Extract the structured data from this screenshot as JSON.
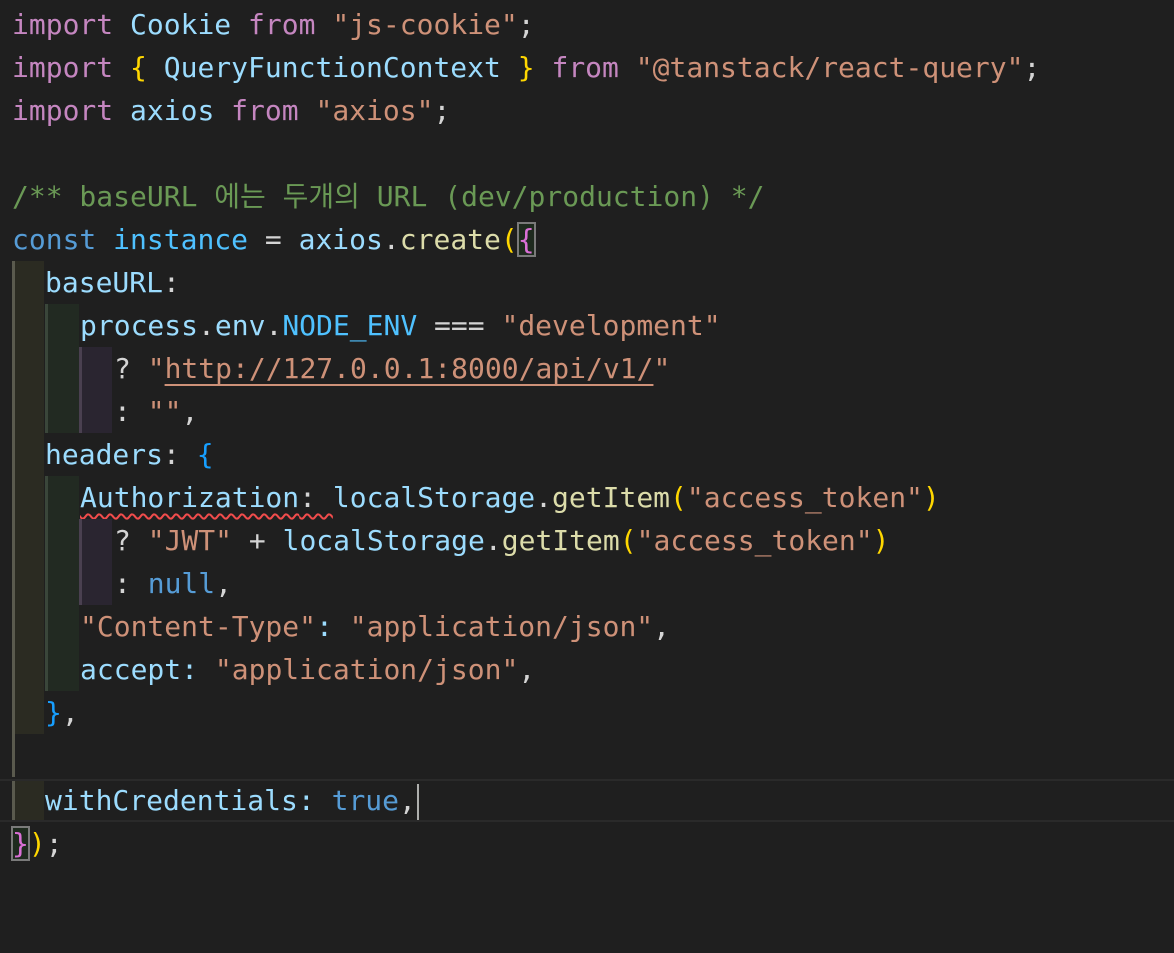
{
  "editor": {
    "theme_colors": {
      "background": "#1f1f1f",
      "keyword": "#c586c0",
      "storage": "#569cd6",
      "variable": "#9cdcfe",
      "constant": "#4fc1ff",
      "function": "#dcdcaa",
      "string": "#ce9178",
      "comment": "#6a9955",
      "error_squiggle": "#f14c4c"
    },
    "lines": {
      "l1": {
        "kw": "import",
        "name": "Cookie",
        "from": "from",
        "source": "\"js-cookie\"",
        "semi": ";"
      },
      "l2": {
        "kw": "import",
        "open": "{",
        "name": "QueryFunctionContext",
        "close": "}",
        "from": "from",
        "source": "\"@tanstack/react-query\"",
        "semi": ";"
      },
      "l3": {
        "kw": "import",
        "name": "axios",
        "from": "from",
        "source": "\"axios\"",
        "semi": ";"
      },
      "l5": {
        "comment": "/** baseURL 에는 두개의 URL (dev/production) */"
      },
      "l6": {
        "kw": "const",
        "name": "instance",
        "eq": " = ",
        "obj": "axios",
        "dot": ".",
        "fn": "create",
        "paren": "(",
        "brace": "{"
      },
      "l7": {
        "key": "baseURL",
        "colon": ":"
      },
      "l8": {
        "a": "process",
        "dot1": ".",
        "b": "env",
        "dot2": ".",
        "c": "NODE_ENV",
        "op": " === ",
        "str": "\"development\""
      },
      "l9": {
        "op": "? ",
        "q1": "\"",
        "url": "http://127.0.0.1:8000/api/v1/",
        "q2": "\""
      },
      "l10": {
        "op": ": ",
        "str": "\"\"",
        "comma": ","
      },
      "l11": {
        "key": "headers",
        "colon": ": ",
        "brace": "{"
      },
      "l12": {
        "key": "Authorization",
        "colon": ": ",
        "obj": "localStorage",
        "dot": ".",
        "fn": "getItem",
        "p1": "(",
        "str": "\"access_token\"",
        "p2": ")"
      },
      "l13": {
        "op": "? ",
        "s1": "\"JWT\"",
        "plus": " + ",
        "obj": "localStorage",
        "dot": ".",
        "fn": "getItem",
        "p1": "(",
        "str": "\"access_token\"",
        "p2": ")"
      },
      "l14": {
        "op": ": ",
        "lit": "null",
        "comma": ","
      },
      "l15": {
        "key": "\"Content-Type\"",
        "colon": ": ",
        "str": "\"application/json\"",
        "comma": ","
      },
      "l16": {
        "key": "accept",
        "colon": ": ",
        "str": "\"application/json\"",
        "comma": ","
      },
      "l17": {
        "brace": "}",
        "comma": ","
      },
      "l19": {
        "key": "withCredentials",
        "colon": ": ",
        "lit": "true",
        "comma": ","
      },
      "l20": {
        "brace": "}",
        "paren": ")",
        "semi": ";"
      }
    }
  }
}
